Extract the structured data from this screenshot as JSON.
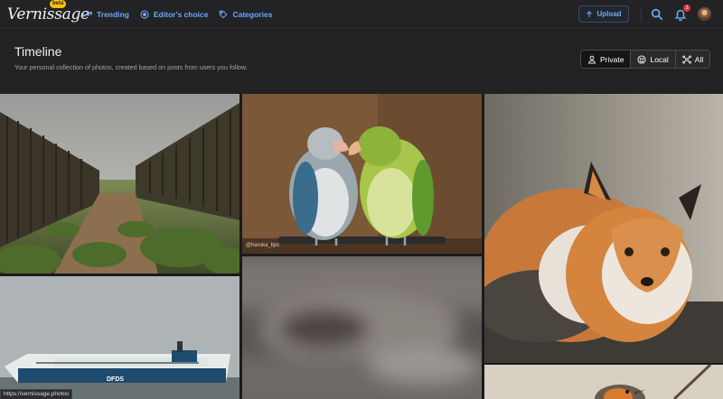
{
  "app": {
    "logo": "Vernissage",
    "beta_badge": "beta"
  },
  "nav": {
    "trending": "Trending",
    "editors_choice": "Editor's choice",
    "categories": "Categories"
  },
  "toolbar": {
    "upload": "Upload",
    "notification_count": "3"
  },
  "header": {
    "title": "Timeline",
    "subtitle": "Your personal collection of photos, created based on posts from users you follow."
  },
  "timeline_filters": [
    {
      "label": "Private",
      "icon": "person-icon"
    },
    {
      "label": "Local",
      "icon": "smiley-icon"
    },
    {
      "label": "All",
      "icon": "network-icon"
    }
  ],
  "photos": [
    {
      "subject": "pine-forest-clearing"
    },
    {
      "subject": "two-parrots",
      "credit": "@haruka_bpc"
    },
    {
      "subject": "red-fox"
    },
    {
      "subject": "blurred-photo"
    },
    {
      "subject": "ferry-ship",
      "ship_text": "DFDS"
    },
    {
      "subject": "small-bird"
    }
  ],
  "status_bar": {
    "url": "https://vernissage.photos"
  },
  "colors": {
    "accent": "#6ea8fe",
    "background": "#1b1b1d",
    "badge": "#dc3545",
    "beta": "#ffc107"
  }
}
